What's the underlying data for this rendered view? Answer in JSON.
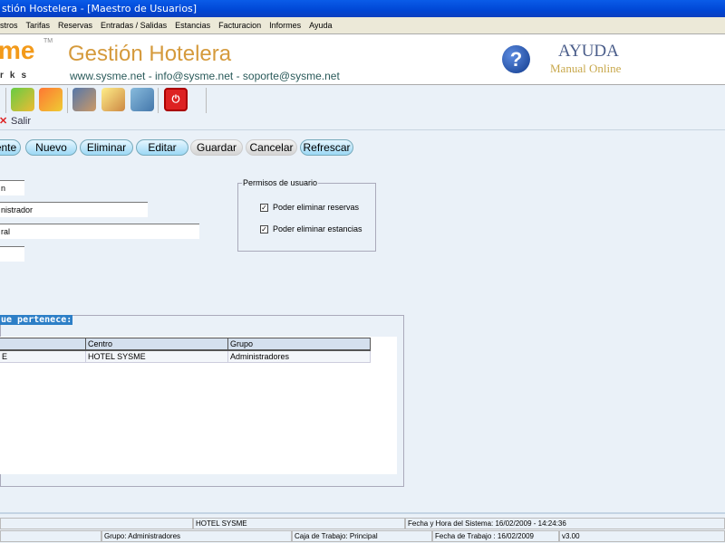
{
  "window": {
    "title": "stión Hostelera - [Maestro de Usuarios]"
  },
  "menu": [
    "stros",
    "Tarifas",
    "Reservas",
    "Entradas / Salidas",
    "Estancias",
    "Facturacion",
    "Informes",
    "Ayuda"
  ],
  "banner": {
    "logo": "me",
    "logo_sub": "rks",
    "title": "Gestión Hotelera",
    "contact": "www.sysme.net - info@sysme.net - soporte@sysme.net",
    "help_title": "AYUDA",
    "help_sub": "Manual Online"
  },
  "salir": "Salir",
  "actions": [
    "ente",
    "Nuevo",
    "Eliminar",
    "Editar",
    "Guardar",
    "Cancelar",
    "Refrescar"
  ],
  "form": {
    "field1": "n",
    "field2": "nistrador",
    "field3": "ral",
    "field4": ""
  },
  "permissions": {
    "title": "Permisos de usuario",
    "items": [
      {
        "label": "Poder eliminar reservas",
        "checked": true
      },
      {
        "label": "Poder eliminar estancias",
        "checked": true
      }
    ]
  },
  "table": {
    "title": "ue pertenece:",
    "headers": [
      "",
      "Centro",
      "Grupo"
    ],
    "rows": [
      [
        "E",
        "HOTEL SYSME",
        "Administradores"
      ]
    ]
  },
  "status": {
    "hotel": "HOTEL SYSME",
    "system_datetime": "Fecha y Hora del Sistema: 16/02/2009 - 14:24:36",
    "group": "Grupo: Administradores",
    "cash": "Caja de Trabajo:  Principal",
    "work_date": "Fecha de Trabajo : 16/02/2009",
    "version": "v3.00"
  }
}
